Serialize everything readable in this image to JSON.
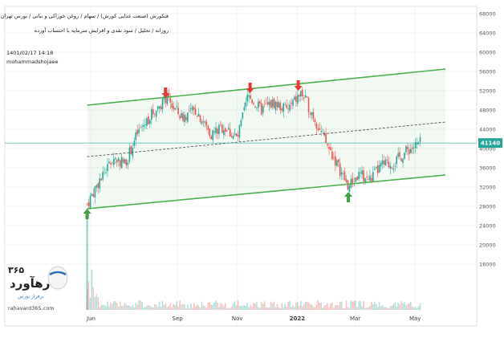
{
  "header": {
    "line1": "فنکورش (صنعت غذایی کورش) / سهام / روغن خوراکی و نباتی / بورس تهران",
    "line2": "روزانه / تحلیل / سود نقدی و افزایش سرمایه با احتساب آورده",
    "timestamp": "1401/02/17 14:18",
    "author": "mohammadshojaee"
  },
  "logo": {
    "number": "۳۶۵",
    "brand": "رهآورد",
    "tagline": "برفراز بورس",
    "site": "rahavard365.com"
  },
  "chart_data": {
    "type": "candlestick",
    "symbol": "فنکورش",
    "interval": "daily",
    "x_tick_labels": [
      "Jun",
      "Sep",
      "Nov",
      "2022",
      "Mar",
      "May"
    ],
    "y_tick_labels": [
      16000,
      20000,
      24000,
      28000,
      32000,
      36000,
      40000,
      44000,
      48000,
      52000,
      56000,
      60000,
      64000,
      68000
    ],
    "ylim": [
      12000,
      69000
    ],
    "last_price": 41140,
    "last_price_label": "41140",
    "price_path": [
      [
        "2021-06-01",
        28500
      ],
      [
        "2021-06-15",
        34000
      ],
      [
        "2021-06-28",
        38000
      ],
      [
        "2021-07-10",
        37000
      ],
      [
        "2021-07-22",
        43000
      ],
      [
        "2021-08-05",
        47000
      ],
      [
        "2021-08-20",
        50500
      ],
      [
        "2021-09-05",
        46500
      ],
      [
        "2021-09-20",
        48000
      ],
      [
        "2021-10-05",
        43000
      ],
      [
        "2021-10-18",
        44500
      ],
      [
        "2021-11-01",
        42000
      ],
      [
        "2021-11-12",
        51000
      ],
      [
        "2021-11-25",
        48000
      ],
      [
        "2021-12-08",
        49500
      ],
      [
        "2021-12-22",
        48000
      ],
      [
        "2022-01-05",
        51500
      ],
      [
        "2022-01-16",
        47500
      ],
      [
        "2022-01-28",
        42000
      ],
      [
        "2022-02-10",
        37000
      ],
      [
        "2022-02-22",
        32000
      ],
      [
        "2022-03-05",
        34500
      ],
      [
        "2022-03-16",
        33500
      ],
      [
        "2022-03-28",
        36500
      ],
      [
        "2022-04-10",
        37000
      ],
      [
        "2022-04-22",
        39500
      ],
      [
        "2022-05-07",
        41140
      ]
    ],
    "channel": {
      "upper": [
        [
          "2021-06-01",
          49000
        ],
        [
          "2022-06-01",
          56500
        ]
      ],
      "lower": [
        [
          "2021-06-01",
          27500
        ],
        [
          "2022-06-01",
          34500
        ]
      ],
      "midline": [
        [
          "2021-06-01",
          38300
        ],
        [
          "2022-06-01",
          45500
        ]
      ]
    },
    "price_line": 41140,
    "markers": {
      "sell": [
        [
          "2021-08-20",
          52000
        ],
        [
          "2021-11-14",
          53000
        ],
        [
          "2022-01-02",
          53500
        ]
      ],
      "buy": [
        [
          "2021-06-01",
          26000
        ],
        [
          "2022-02-22",
          29500
        ]
      ]
    },
    "colors": {
      "up": "#26a69a",
      "down": "#ef5350",
      "channel": "#4caf50",
      "price_line": "#26a69a"
    }
  }
}
